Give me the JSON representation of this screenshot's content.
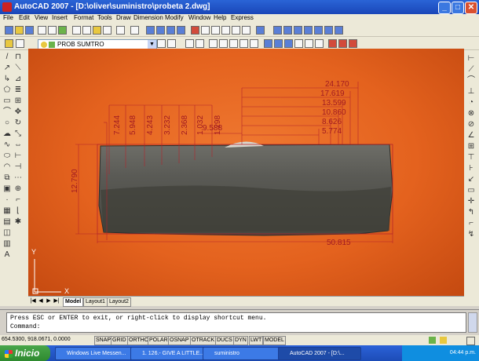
{
  "window": {
    "title": "AutoCAD 2007 - [D:\\oliver\\suministro\\probeta 2.dwg]"
  },
  "menu": [
    "File",
    "Edit",
    "View",
    "Insert",
    "Format",
    "Tools",
    "Draw",
    "Dimension",
    "Modify",
    "Window",
    "Help",
    "Express"
  ],
  "layer_dropdown": {
    "value": "PROB SUMTRO"
  },
  "dimensions": {
    "horizontal": [
      "24.170",
      "17.619",
      "13.599",
      "10.860",
      "8.626",
      "5.774"
    ],
    "vertical": [
      "7.244",
      "5.948",
      "4.243",
      "3.232",
      "2.368",
      "1.032",
      "1.298"
    ],
    "mid": "9.588",
    "left_height": "12.790",
    "bottom_width": "50.815"
  },
  "ucs": {
    "y_label": "Y",
    "x_label": "X"
  },
  "layout_tabs": [
    "Model",
    "Layout1",
    "Layout2"
  ],
  "command": {
    "line1": "Press ESC or ENTER to exit, or right-click to display shortcut menu.",
    "prompt": "Command:"
  },
  "status": {
    "coords": "654.5300, 918.0671, 0.0000",
    "toggles": [
      "SNAP",
      "GRID",
      "ORTHO",
      "POLAR",
      "OSNAP",
      "OTRACK",
      "DUCS",
      "DYN",
      "LWT",
      "MODEL"
    ]
  },
  "taskbar": {
    "start": "Inicio",
    "tasks": [
      "Windows Live Messen...",
      "1. 126.- GIVE A LITTLE...",
      "suministro",
      "AutoCAD 2007 - [D:\\..."
    ],
    "clock": "04:44 p.m."
  },
  "colors": {
    "background_photo": "#e4621e",
    "dimension_lines": "#b4232a"
  }
}
